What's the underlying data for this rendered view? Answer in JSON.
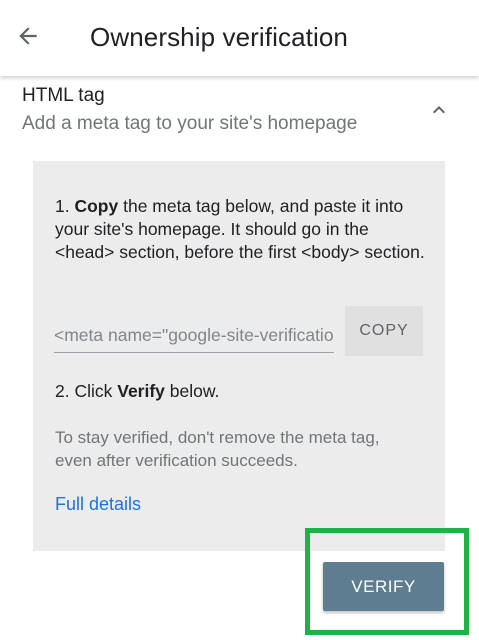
{
  "header": {
    "title": "Ownership verification",
    "back_icon": "arrow-back-icon"
  },
  "section": {
    "title": "HTML tag",
    "subtitle": "Add a meta tag to your site's homepage",
    "toggle_icon": "chevron-up-icon"
  },
  "instructions": {
    "step1_number": "1.",
    "step1_bold": "Copy",
    "step1_rest": " the meta tag below, and paste it into your site's homepage. It should go in the <head> section, before the first <body> section.",
    "meta_tag_value": "<meta name=\"google-site-verification\"",
    "copy_label": "COPY",
    "step2_prefix": "2. Click ",
    "step2_bold": "Verify",
    "step2_suffix": " below.",
    "note": "To stay verified, don't remove the meta tag, even after verification succeeds.",
    "details_link": "Full details"
  },
  "actions": {
    "verify_label": "VERIFY"
  },
  "colors": {
    "accent_link": "#1a73e8",
    "verify_button": "#5e7d90",
    "highlight": "#1db347",
    "card_background": "#ececec"
  }
}
